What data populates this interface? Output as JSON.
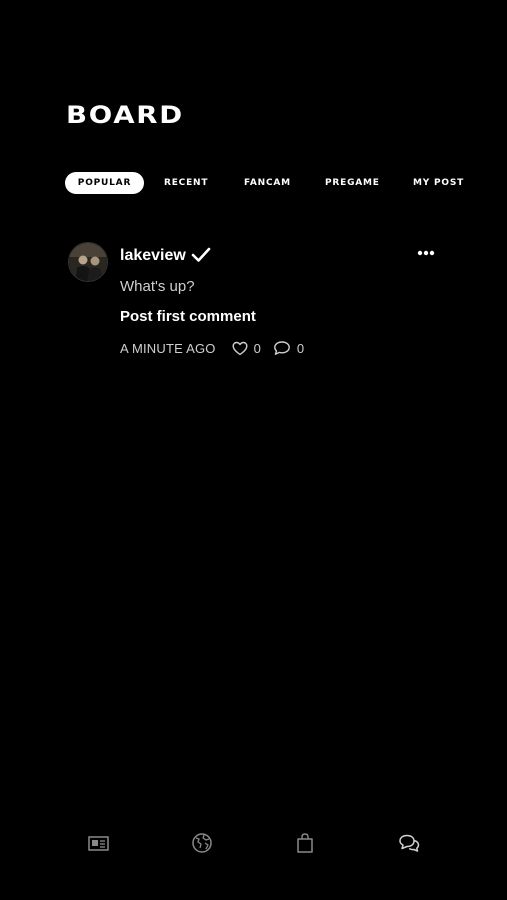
{
  "header": {
    "title": "BOARD"
  },
  "tabs": [
    {
      "label": "POPULAR",
      "active": true
    },
    {
      "label": "RECENT",
      "active": false
    },
    {
      "label": "FANCAM",
      "active": false
    },
    {
      "label": "PREGAME",
      "active": false
    },
    {
      "label": "MY POST",
      "active": false
    }
  ],
  "post": {
    "username": "lakeview",
    "verified_icon": "checkmark-icon",
    "body": "What's up?",
    "comment_cta": "Post first comment",
    "time": "A MINUTE AGO",
    "likes": "0",
    "comments": "0"
  },
  "bottom_nav": [
    {
      "icon": "news-icon"
    },
    {
      "icon": "globe-icon"
    },
    {
      "icon": "shopping-bag-icon"
    },
    {
      "icon": "chat-bubbles-icon"
    }
  ],
  "colors": {
    "background": "#000000",
    "text": "#ffffff",
    "muted": "#cfcfcf",
    "nav_icon": "#8a8a8a"
  }
}
